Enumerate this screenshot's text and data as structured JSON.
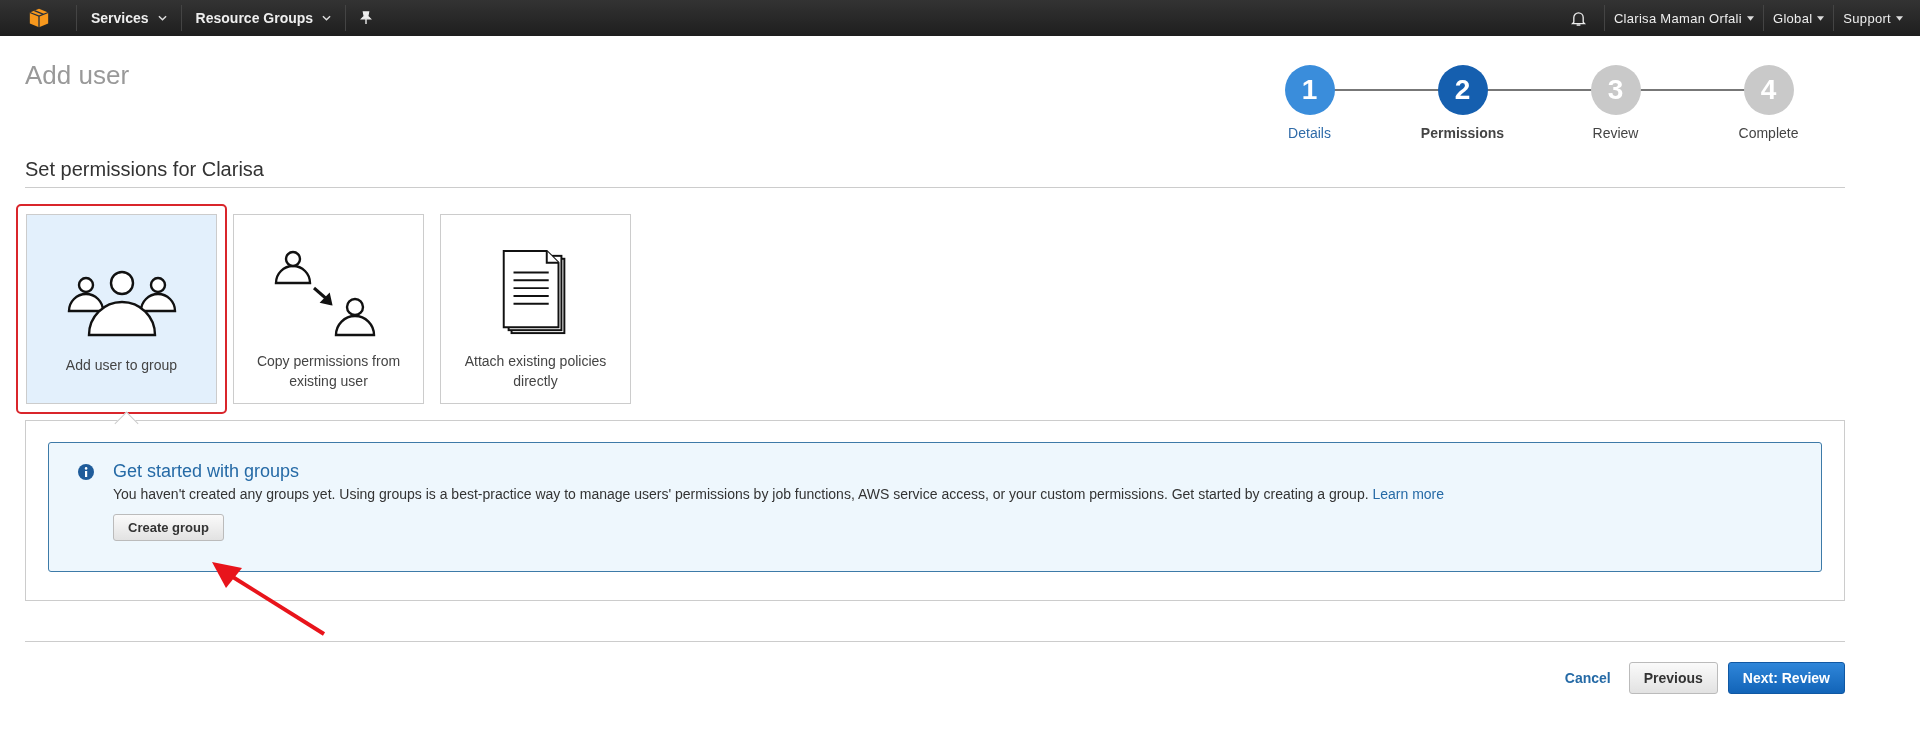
{
  "navbar": {
    "menus": [
      {
        "label": "Services"
      },
      {
        "label": "Resource Groups"
      }
    ],
    "right_menus": [
      {
        "label": "Clarisa Maman Orfali"
      },
      {
        "label": "Global"
      },
      {
        "label": "Support"
      }
    ]
  },
  "page_title": "Add user",
  "steps": [
    {
      "number": "1",
      "label": "Details",
      "completed": true,
      "selected": false
    },
    {
      "number": "2",
      "label": "Permissions",
      "completed": false,
      "selected": true
    },
    {
      "number": "3",
      "label": "Review",
      "completed": false,
      "selected": false
    },
    {
      "number": "4",
      "label": "Complete",
      "completed": false,
      "selected": false
    }
  ],
  "section_title": "Set permissions for Clarisa",
  "options": [
    {
      "kind": "group",
      "label": "Add user to group",
      "selected": true
    },
    {
      "kind": "copy",
      "label": "Copy permissions from existing user",
      "selected": false
    },
    {
      "kind": "policy",
      "label": "Attach existing policies directly",
      "selected": false
    }
  ],
  "info": {
    "title": "Get started with groups",
    "text": "You haven't created any groups yet. Using groups is a best-practice way to manage users' permissions by job functions, AWS service access, or your custom permissions. Get started by creating a group.",
    "link": "Learn more",
    "button": "Create group"
  },
  "footer": {
    "cancel": "Cancel",
    "previous": "Previous",
    "next": "Next: Review"
  }
}
